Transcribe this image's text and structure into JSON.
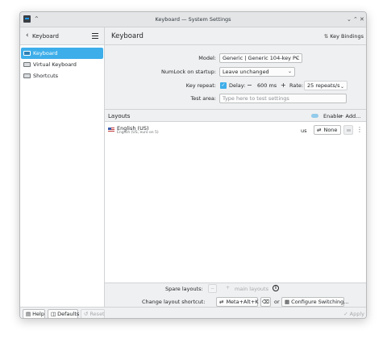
{
  "window": {
    "title": "Keyboard — System Settings"
  },
  "sidebar": {
    "back_label": "Keyboard",
    "items": [
      {
        "label": "Keyboard",
        "active": true
      },
      {
        "label": "Virtual Keyboard",
        "active": false
      },
      {
        "label": "Shortcuts",
        "active": false
      }
    ]
  },
  "header": {
    "title": "Keyboard",
    "key_bindings_label": "Key Bindings"
  },
  "form": {
    "model_label": "Model:",
    "model_value": "Generic | Generic 104-key PC",
    "numlock_label": "NumLock on startup:",
    "numlock_value": "Leave unchanged",
    "key_repeat_label": "Key repeat:",
    "delay_label": "Delay:",
    "delay_minus": "−",
    "delay_value": "600 ms",
    "delay_plus": "+",
    "rate_label": "Rate:",
    "rate_value": "25 repeats/s",
    "test_area_label": "Test area:",
    "test_area_placeholder": "Type here to test settings"
  },
  "layouts": {
    "title": "Layouts",
    "enable_label": "Enable",
    "add_label": "+ Add...",
    "items": [
      {
        "name": "English (US)",
        "description": "English (US, euro on 5)",
        "code": "us",
        "shortcut": "None"
      }
    ]
  },
  "spare": {
    "label": "Spare layouts:",
    "minus": "−",
    "plus": "+",
    "main_layouts_label": "main layouts",
    "info_symbol": "i"
  },
  "change_shortcut": {
    "label": "Change layout shortcut:",
    "shortcut_value": "Meta+Alt+K",
    "or_label": "or",
    "configure_label": "Configure Switching..."
  },
  "footer": {
    "help_label": "Help",
    "defaults_label": "Defaults",
    "reset_label": "Reset",
    "apply_label": "Apply"
  },
  "colors": {
    "accent": "#3daee9",
    "window_bg": "#eff0f1",
    "view_bg": "#ffffff"
  }
}
